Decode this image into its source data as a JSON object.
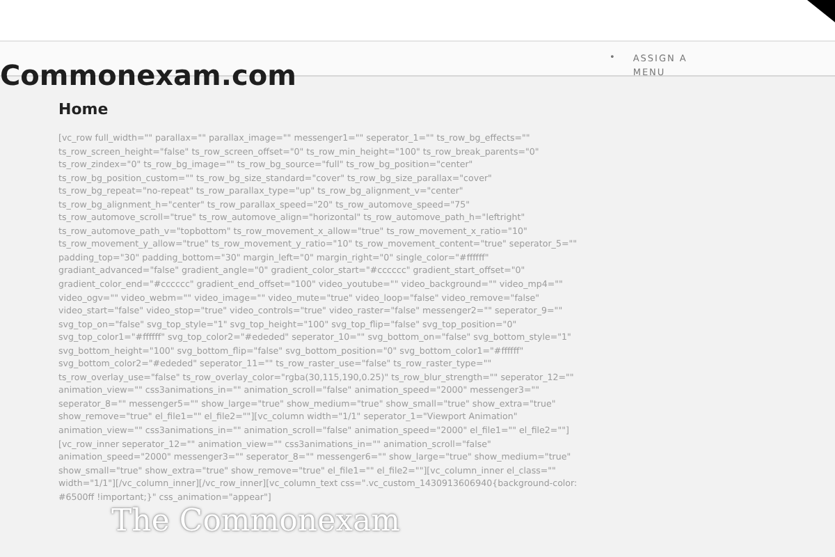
{
  "site": {
    "title": "Commonexam.com"
  },
  "nav": {
    "items": [
      {
        "bullet": "•",
        "label": "ASSIGN A MENU"
      }
    ]
  },
  "page": {
    "heading": "Home",
    "shortcode_lines": [
      "[vc_row full_width=\"\" parallax=\"\" parallax_image=\"\" messenger1=\"\" seperator_1=\"\" ts_row_bg_effects=\"\"",
      "ts_row_screen_height=\"false\" ts_row_screen_offset=\"0\" ts_row_min_height=\"100\" ts_row_break_parents=\"0\"",
      "ts_row_zindex=\"0\" ts_row_bg_image=\"\" ts_row_bg_source=\"full\" ts_row_bg_position=\"center\"",
      "ts_row_bg_position_custom=\"\" ts_row_bg_size_standard=\"cover\" ts_row_bg_size_parallax=\"cover\"",
      "ts_row_bg_repeat=\"no-repeat\" ts_row_parallax_type=\"up\" ts_row_bg_alignment_v=\"center\"",
      "ts_row_bg_alignment_h=\"center\" ts_row_parallax_speed=\"20\" ts_row_automove_speed=\"75\"",
      "ts_row_automove_scroll=\"true\" ts_row_automove_align=\"horizontal\" ts_row_automove_path_h=\"leftright\"",
      "ts_row_automove_path_v=\"topbottom\" ts_row_movement_x_allow=\"true\" ts_row_movement_x_ratio=\"10\"",
      "ts_row_movement_y_allow=\"true\" ts_row_movement_y_ratio=\"10\" ts_row_movement_content=\"true\" seperator_5=\"\"",
      "padding_top=\"30\" padding_bottom=\"30\" margin_left=\"0\" margin_right=\"0\" single_color=\"#ffffff\"",
      "gradiant_advanced=\"false\" gradient_angle=\"0\" gradient_color_start=\"#cccccc\" gradient_start_offset=\"0\"",
      "gradient_color_end=\"#cccccc\" gradient_end_offset=\"100\" video_youtube=\"\" video_background=\"\" video_mp4=\"\"",
      "video_ogv=\"\" video_webm=\"\" video_image=\"\" video_mute=\"true\" video_loop=\"false\" video_remove=\"false\"",
      "video_start=\"false\" video_stop=\"true\" video_controls=\"true\" video_raster=\"false\" messenger2=\"\" seperator_9=\"\"",
      "svg_top_on=\"false\" svg_top_style=\"1\" svg_top_height=\"100\" svg_top_flip=\"false\" svg_top_position=\"0\"",
      "svg_top_color1=\"#ffffff\" svg_top_color2=\"#ededed\" seperator_10=\"\" svg_bottom_on=\"false\" svg_bottom_style=\"1\"",
      "svg_bottom_height=\"100\" svg_bottom_flip=\"false\" svg_bottom_position=\"0\" svg_bottom_color1=\"#ffffff\"",
      "svg_bottom_color2=\"#ededed\" seperator_11=\"\" ts_row_raster_use=\"false\" ts_row_raster_type=\"\"",
      "ts_row_overlay_use=\"false\" ts_row_overlay_color=\"rgba(30,115,190,0.25)\" ts_row_blur_strength=\"\" seperator_12=\"\"",
      "animation_view=\"\" css3animations_in=\"\" animation_scroll=\"false\" animation_speed=\"2000\" messenger3=\"\"",
      "seperator_8=\"\" messenger5=\"\" show_large=\"true\" show_medium=\"true\" show_small=\"true\" show_extra=\"true\"",
      "show_remove=\"true\" el_file1=\"\" el_file2=\"\"][vc_column width=\"1/1\" seperator_1=\"Viewport Animation\"",
      "animation_view=\"\" css3animations_in=\"\" animation_scroll=\"false\" animation_speed=\"2000\" el_file1=\"\" el_file2=\"\"]",
      "[vc_row_inner seperator_12=\"\" animation_view=\"\" css3animations_in=\"\" animation_scroll=\"false\"",
      "animation_speed=\"2000\" messenger3=\"\" seperator_8=\"\" messenger6=\"\" show_large=\"true\" show_medium=\"true\"",
      "show_small=\"true\" show_extra=\"true\" show_remove=\"true\" el_file1=\"\" el_file2=\"\"][vc_column_inner el_class=\"\"",
      "width=\"1/1\"][/vc_column_inner][/vc_row_inner][vc_column_text css=\".vc_custom_1430913606940{background-color:",
      "#6500ff !important;}\" css_animation=\"appear\"]"
    ],
    "banner": "The Commonexam"
  }
}
